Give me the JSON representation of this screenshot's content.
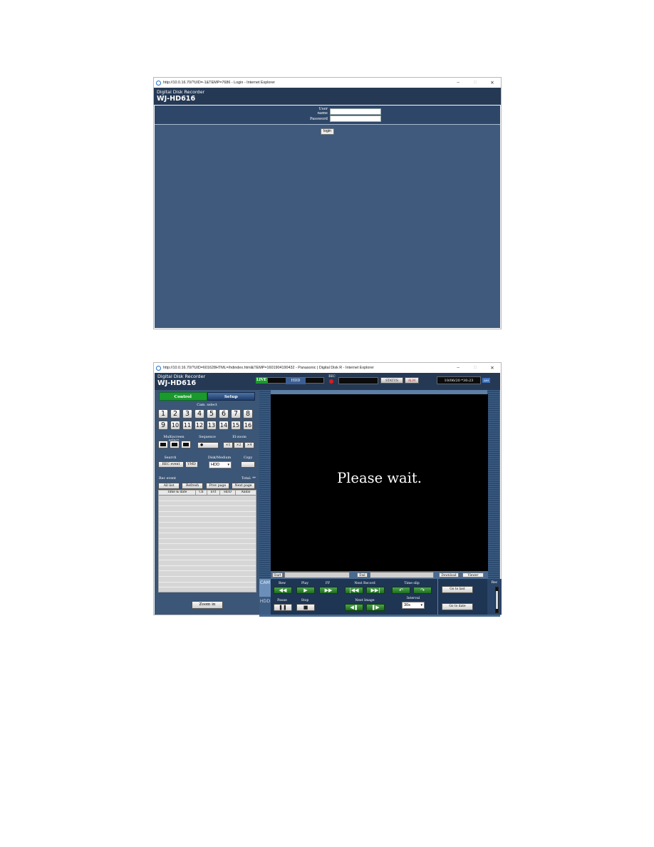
{
  "login_window": {
    "title": "http://10.0.16.70/?UID=-1&TEMP=7686 - Login - Internet Explorer",
    "controls": [
      "–",
      "□",
      "✕"
    ],
    "header": {
      "subtitle": "Digital Disk Recorder",
      "model": "WJ-HD616"
    },
    "username_label": "User name",
    "password_label": "Password",
    "username_value": "",
    "password_value": "",
    "login_button": "login"
  },
  "main_window": {
    "title": "http://10.0.16.70/?UID=601628HTML=/hdindex.html&TEMP=1601904190432 - Panasonic | Digital Disk R - Internet Explorer",
    "controls": [
      "–",
      "□",
      "✕"
    ],
    "header": {
      "subtitle": "Digital Disk Recorder",
      "model": "WJ-HD616"
    },
    "status": {
      "live_badge": "LIVE",
      "hdd_badge": "HDD",
      "rec_label": "REC",
      "status_buttons": [
        "STATUS",
        "ALM"
      ],
      "datetime": "10/06/20 *30:23",
      "am_badge": "AM"
    },
    "tabs": {
      "control": "Control",
      "setup": "Setup"
    },
    "cam_select": {
      "label": "Cam. select",
      "cameras": [
        "1",
        "2",
        "3",
        "4",
        "5",
        "6",
        "7",
        "8",
        "9",
        "10",
        "11",
        "12",
        "13",
        "14",
        "15",
        "16"
      ]
    },
    "multiscreen_label": "Multiscreen select",
    "sequence": {
      "label": "Sequence"
    },
    "el_zoom": {
      "label": "El-zoom",
      "buttons": [
        "×1",
        "×2",
        "×4"
      ]
    },
    "search": {
      "label": "Search",
      "rec_event": "REC event",
      "vmd": "VMD"
    },
    "disk_medium": {
      "label": "Disk/Medium",
      "value": "HDD"
    },
    "copy": {
      "label": "Copy"
    },
    "rec_event_list": {
      "label": "Rec event",
      "total": "Total: **",
      "buttons": [
        "All list",
        "Refresh",
        "Prev page",
        "Next page"
      ],
      "columns": [
        "Time & date",
        "Ch",
        "Evt",
        "HDD",
        "Audio"
      ]
    },
    "zoom_in": "Zoom in",
    "video_message": "Please wait.",
    "timeline": {
      "start": "Start",
      "end": "End",
      "download": "Download",
      "viewer": "Viewer"
    },
    "side_tabs": {
      "cam": "CAM",
      "hdd": "HDD"
    },
    "playback": {
      "rew": "Rew",
      "play": "Play",
      "ff": "FF",
      "next_record": "Next Record",
      "time_skip": "Time slip",
      "pause": "Pause",
      "stop": "Stop",
      "next_image": "Next Image",
      "interval_label": "Interval",
      "interval_value": "30s",
      "go_to_last": "Go to last",
      "go_to_date": "Go to date",
      "rec": "Rec"
    }
  }
}
